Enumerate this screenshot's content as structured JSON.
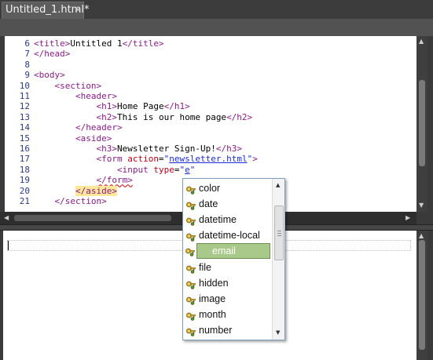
{
  "tab": {
    "title": "Untitled_1.html*",
    "close": "×"
  },
  "code_lines": [
    {
      "num": "6",
      "parts": [
        [
          "tag",
          "<title>"
        ],
        [
          "text",
          "Untitled 1"
        ],
        [
          "tag",
          "</title>"
        ]
      ]
    },
    {
      "num": "7",
      "parts": [
        [
          "tag",
          "</head>"
        ]
      ]
    },
    {
      "num": "8",
      "parts": []
    },
    {
      "num": "9",
      "parts": [
        [
          "tag",
          "<body>"
        ]
      ]
    },
    {
      "num": "10",
      "parts": [
        [
          "text",
          "    "
        ],
        [
          "tag",
          "<section>"
        ]
      ]
    },
    {
      "num": "11",
      "parts": [
        [
          "text",
          "        "
        ],
        [
          "tag",
          "<header>"
        ]
      ]
    },
    {
      "num": "12",
      "parts": [
        [
          "text",
          "            "
        ],
        [
          "tag",
          "<h1>"
        ],
        [
          "text",
          "Home Page"
        ],
        [
          "tag",
          "</h1>"
        ]
      ]
    },
    {
      "num": "13",
      "parts": [
        [
          "text",
          "            "
        ],
        [
          "tag",
          "<h2>"
        ],
        [
          "text",
          "This is our home page"
        ],
        [
          "tag",
          "</h2>"
        ]
      ]
    },
    {
      "num": "14",
      "parts": [
        [
          "text",
          "        "
        ],
        [
          "tag",
          "</header>"
        ]
      ]
    },
    {
      "num": "15",
      "parts": [
        [
          "text",
          "        "
        ],
        [
          "tag",
          "<aside>"
        ]
      ]
    },
    {
      "num": "16",
      "parts": [
        [
          "text",
          "            "
        ],
        [
          "tag",
          "<h3>"
        ],
        [
          "text",
          "Newsletter Sign-Up!"
        ],
        [
          "tag",
          "</h3>"
        ]
      ]
    },
    {
      "num": "17",
      "parts": [
        [
          "text",
          "            "
        ],
        [
          "tag",
          "<form "
        ],
        [
          "attr",
          "action"
        ],
        [
          "text",
          "="
        ],
        [
          "val",
          "\""
        ],
        [
          "valul",
          "newsletter.html"
        ],
        [
          "val",
          "\""
        ],
        [
          "tag",
          ">"
        ]
      ]
    },
    {
      "num": "18",
      "parts": [
        [
          "text",
          "                "
        ],
        [
          "tag",
          "<input "
        ],
        [
          "attr",
          "type"
        ],
        [
          "text",
          "="
        ],
        [
          "val",
          "\""
        ],
        [
          "valul",
          "e"
        ],
        [
          "val",
          "\""
        ]
      ]
    },
    {
      "num": "19",
      "parts": [
        [
          "text",
          "            "
        ],
        [
          "tagwavy",
          "</form>"
        ]
      ]
    },
    {
      "num": "20",
      "parts": [
        [
          "text",
          "        "
        ],
        [
          "taghl",
          "</aside>"
        ]
      ]
    },
    {
      "num": "21",
      "parts": [
        [
          "text",
          "    "
        ],
        [
          "tag",
          "</section>"
        ]
      ]
    }
  ],
  "autocomplete": {
    "items": [
      "color",
      "date",
      "datetime",
      "datetime-local",
      "email",
      "file",
      "hidden",
      "image",
      "month",
      "number"
    ],
    "selected": "email",
    "icon": "key-icon"
  },
  "colors": {
    "tag": "#8b1a8b",
    "attribute": "#c0001a",
    "value": "#1a2bd6",
    "selection": "#a9c98a",
    "highlight": "#ffe79a"
  }
}
